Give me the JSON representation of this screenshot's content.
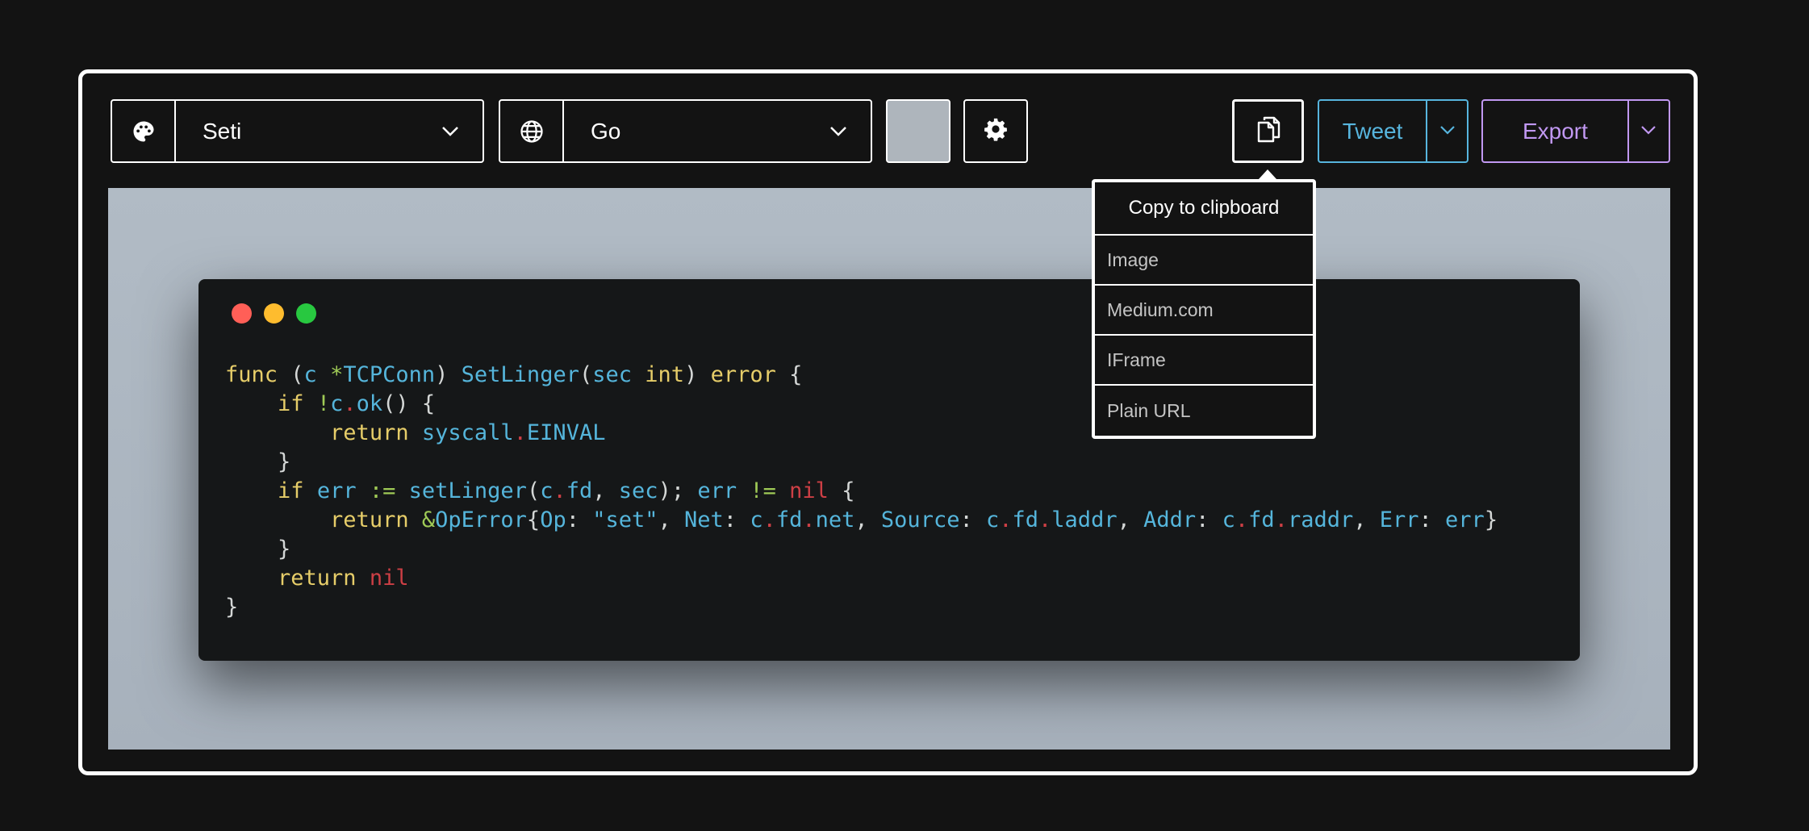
{
  "toolbar": {
    "theme": {
      "value": "Seti",
      "icon": "palette-icon"
    },
    "language": {
      "value": "Go",
      "icon": "globe-icon"
    },
    "background_color": "#aeb5bc",
    "settings_icon": "gear-icon",
    "copy_icon": "copy-icon",
    "tweet": {
      "label": "Tweet",
      "color": "#57b5de"
    },
    "export": {
      "label": "Export",
      "color": "#c198f2"
    }
  },
  "window_controls": [
    "#ff5f57",
    "#febc2e",
    "#28c840"
  ],
  "code": {
    "language": "Go",
    "colors": {
      "default": "#d4d7d6",
      "keyword": "#e6cd69",
      "type": "#e6cd69",
      "func": "#55b5db",
      "ident": "#55b5db",
      "dot": "#cd3f45",
      "nil": "#cd3f45",
      "string": "#55b5db",
      "op": "#9fca56"
    },
    "lines": [
      [
        [
          "func",
          "keyword"
        ],
        [
          " (",
          "default"
        ],
        [
          "c",
          "ident"
        ],
        [
          " ",
          "default"
        ],
        [
          "*",
          "op"
        ],
        [
          "TCPConn",
          "ident"
        ],
        [
          ") ",
          "default"
        ],
        [
          "SetLinger",
          "func"
        ],
        [
          "(",
          "default"
        ],
        [
          "sec",
          "ident"
        ],
        [
          " ",
          "default"
        ],
        [
          "int",
          "type"
        ],
        [
          ") ",
          "default"
        ],
        [
          "error",
          "type"
        ],
        [
          " {",
          "default"
        ]
      ],
      [
        [
          "    ",
          "default"
        ],
        [
          "if",
          "keyword"
        ],
        [
          " ",
          "default"
        ],
        [
          "!",
          "op"
        ],
        [
          "c",
          "ident"
        ],
        [
          ".",
          "dot"
        ],
        [
          "ok",
          "func"
        ],
        [
          "() {",
          "default"
        ]
      ],
      [
        [
          "        ",
          "default"
        ],
        [
          "return",
          "keyword"
        ],
        [
          " ",
          "default"
        ],
        [
          "syscall",
          "ident"
        ],
        [
          ".",
          "dot"
        ],
        [
          "EINVAL",
          "ident"
        ]
      ],
      [
        [
          "    }",
          "default"
        ]
      ],
      [
        [
          "    ",
          "default"
        ],
        [
          "if",
          "keyword"
        ],
        [
          " ",
          "default"
        ],
        [
          "err",
          "ident"
        ],
        [
          " ",
          "default"
        ],
        [
          ":=",
          "op"
        ],
        [
          " ",
          "default"
        ],
        [
          "setLinger",
          "func"
        ],
        [
          "(",
          "default"
        ],
        [
          "c",
          "ident"
        ],
        [
          ".",
          "dot"
        ],
        [
          "fd",
          "ident"
        ],
        [
          ", ",
          "default"
        ],
        [
          "sec",
          "ident"
        ],
        [
          "); ",
          "default"
        ],
        [
          "err",
          "ident"
        ],
        [
          " ",
          "default"
        ],
        [
          "!=",
          "op"
        ],
        [
          " ",
          "default"
        ],
        [
          "nil",
          "nil"
        ],
        [
          " {",
          "default"
        ]
      ],
      [
        [
          "        ",
          "default"
        ],
        [
          "return",
          "keyword"
        ],
        [
          " ",
          "default"
        ],
        [
          "&",
          "op"
        ],
        [
          "OpError",
          "ident"
        ],
        [
          "{",
          "default"
        ],
        [
          "Op",
          "ident"
        ],
        [
          ": ",
          "default"
        ],
        [
          "\"set\"",
          "string"
        ],
        [
          ", ",
          "default"
        ],
        [
          "Net",
          "ident"
        ],
        [
          ": ",
          "default"
        ],
        [
          "c",
          "ident"
        ],
        [
          ".",
          "dot"
        ],
        [
          "fd",
          "ident"
        ],
        [
          ".",
          "dot"
        ],
        [
          "net",
          "ident"
        ],
        [
          ", ",
          "default"
        ],
        [
          "Source",
          "ident"
        ],
        [
          ": ",
          "default"
        ],
        [
          "c",
          "ident"
        ],
        [
          ".",
          "dot"
        ],
        [
          "fd",
          "ident"
        ],
        [
          ".",
          "dot"
        ],
        [
          "laddr",
          "ident"
        ],
        [
          ", ",
          "default"
        ],
        [
          "Addr",
          "ident"
        ],
        [
          ": ",
          "default"
        ],
        [
          "c",
          "ident"
        ],
        [
          ".",
          "dot"
        ],
        [
          "fd",
          "ident"
        ],
        [
          ".",
          "dot"
        ],
        [
          "raddr",
          "ident"
        ],
        [
          ", ",
          "default"
        ],
        [
          "Err",
          "ident"
        ],
        [
          ": ",
          "default"
        ],
        [
          "err",
          "ident"
        ],
        [
          "}",
          "default"
        ]
      ],
      [
        [
          "    }",
          "default"
        ]
      ],
      [
        [
          "    ",
          "default"
        ],
        [
          "return",
          "keyword"
        ],
        [
          " ",
          "default"
        ],
        [
          "nil",
          "nil"
        ]
      ],
      [
        [
          "}",
          "default"
        ]
      ]
    ]
  },
  "copy_menu": {
    "header": "Copy to clipboard",
    "items": [
      "Image",
      "Medium.com",
      "IFrame",
      "Plain URL"
    ]
  }
}
